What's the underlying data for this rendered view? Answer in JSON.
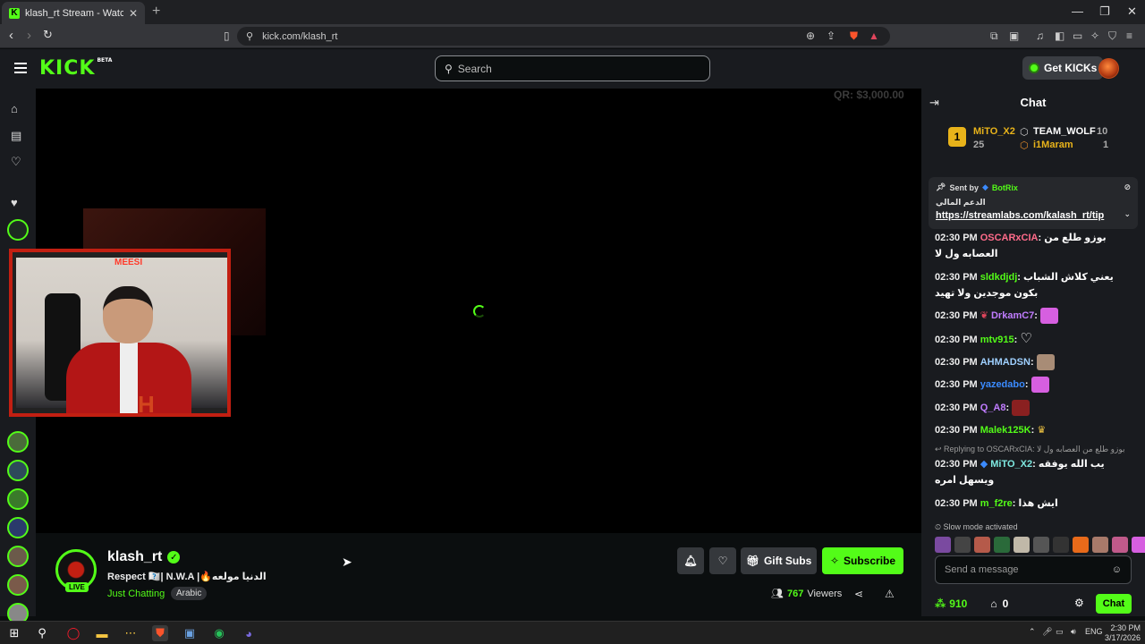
{
  "browser": {
    "tab_title": "klash_rt Stream - Watch Live on Kick",
    "url": "kick.com/klash_rt"
  },
  "header": {
    "logo": "KICK",
    "logo_sup": "BETA",
    "search_placeholder": "Search",
    "get_kicks": "Get KICKs"
  },
  "video": {
    "qr_text": "QR: $3,000.00",
    "sign_text": "MEESI"
  },
  "stream": {
    "username": "klash_rt",
    "live_badge": "LIVE",
    "title": "Respect 🇷🇹| N.W.A |🔥الدنيا مولعه",
    "category": "Just Chatting",
    "tag": "Arabic",
    "gift_subs": "Gift Subs",
    "subscribe": "Subscribe",
    "viewers_count": "767",
    "viewers_label": "Viewers"
  },
  "chat": {
    "title": "Chat",
    "leaderboard": {
      "first": {
        "name": "MiTO_X2",
        "count": "25",
        "rank": "1"
      },
      "second": {
        "name": "TEAM_WOLF",
        "count": "10"
      },
      "third": {
        "name": "i1Maram",
        "count": "1"
      }
    },
    "pinned": {
      "sent_by": "Sent by",
      "sender": "BotRix",
      "text": "الدعم المالي",
      "link": "https://streamlabs.com/kalash_rt/tip"
    },
    "messages": [
      {
        "time": "02:30 PM",
        "user": "OSCARxCIA",
        "color": "#ff6b8a",
        "text": "بوزو طلع من العصابه ول لا"
      },
      {
        "time": "02:30 PM",
        "user": "sldkdjdj",
        "color": "#53fc18",
        "text": "يعني كلاش الشباب بكون موجدين ولا تهيد"
      },
      {
        "time": "02:30 PM",
        "user": "DrkamC7",
        "color": "#c07cff",
        "text": ""
      },
      {
        "time": "02:30 PM",
        "user": "mtv915",
        "color": "#53fc18",
        "text": ""
      },
      {
        "time": "02:30 PM",
        "user": "AHMADSN",
        "color": "#9fd0ff",
        "text": ""
      },
      {
        "time": "02:30 PM",
        "user": "yazedabo",
        "color": "#3b8bff",
        "text": ""
      },
      {
        "time": "02:30 PM",
        "user": "Q_A8",
        "color": "#c07cff",
        "text": ""
      },
      {
        "time": "02:30 PM",
        "user": "Malek125K",
        "color": "#53fc18",
        "text": ""
      },
      {
        "time": "02:30 PM",
        "user": "MiTO_X2",
        "color": "#7ee8e0",
        "text": "يب الله يوفقه ويسهل امره",
        "reply": "Replying to OSCARxCIA: بوزو طلع من العصابه ول لا"
      },
      {
        "time": "02:30 PM",
        "user": "m_f2re",
        "color": "#53fc18",
        "text": "ايش هذا"
      }
    ],
    "slow_mode": "Slow mode activated",
    "input_placeholder": "Send a message",
    "points": "910",
    "gifts": "0",
    "chat_button": "Chat"
  },
  "taskbar": {
    "lang": "ENG",
    "time": "2:30 PM",
    "date": "3/17/2026"
  },
  "colors": {
    "accent": "#53fc18",
    "bg": "#0b0e0f",
    "panel": "#191b1f"
  }
}
